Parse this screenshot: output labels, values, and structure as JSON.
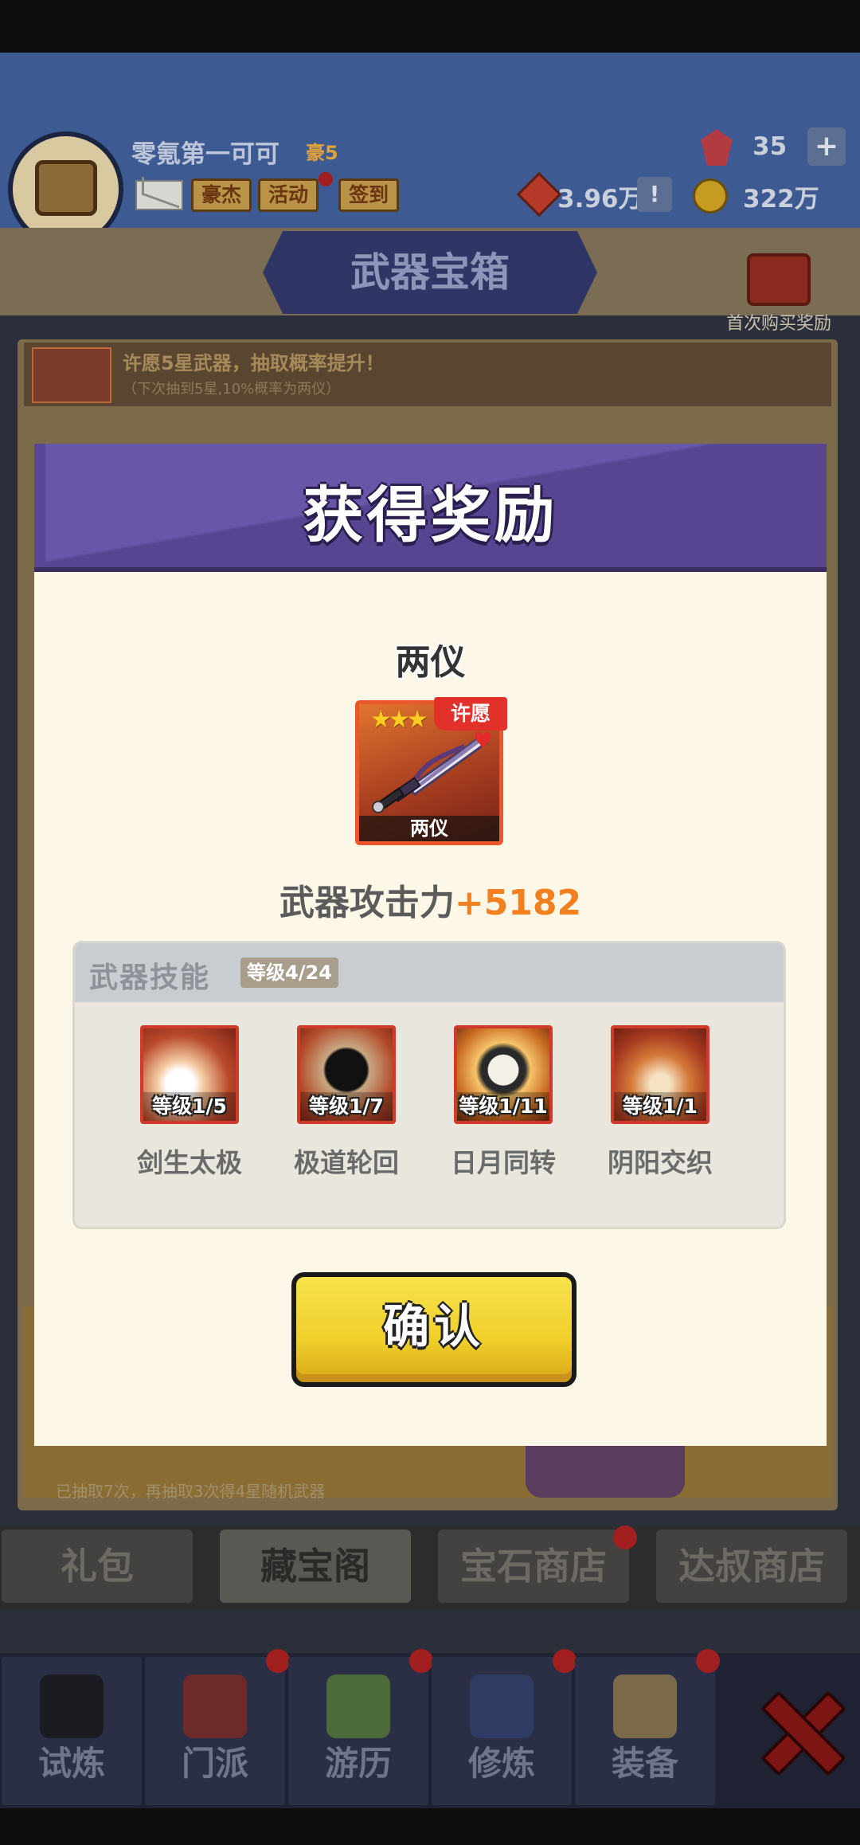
{
  "header": {
    "player_name": "零氪第一可可",
    "vip": "豪5",
    "buttons": [
      "豪杰",
      "活动",
      "签到"
    ],
    "power": "3.96万",
    "gems": "35",
    "gold": "322万",
    "excl": "!",
    "plus": "+"
  },
  "page": {
    "title": "武器宝箱",
    "first_buy_label": "首次购买奖励",
    "wish_text": "许愿5星武器，抽取概率提升！",
    "wish_sub": "（下次抽到5星,10%概率为两仪）",
    "chest_hint": "已抽取7次，再抽取3次得4星随机武器"
  },
  "shop_tabs": [
    "礼包",
    "藏宝阁",
    "宝石商店",
    "达叔商店"
  ],
  "bottom_nav": [
    "试炼",
    "门派",
    "游历",
    "修炼",
    "装备"
  ],
  "modal": {
    "title": "获得奖励",
    "weapon_name": "两仪",
    "card_label": "两仪",
    "stars": "★★★",
    "wish_badge": "许愿",
    "attack_label": "武器攻击力",
    "attack_value": "+5182",
    "skills_title": "武器技能",
    "skills_level": "等级4/24",
    "skills": [
      {
        "name": "剑生太极",
        "level": "等级1/5"
      },
      {
        "name": "极道轮回",
        "level": "等级1/7"
      },
      {
        "name": "日月同转",
        "level": "等级1/11"
      },
      {
        "name": "阴阳交织",
        "level": "等级1/1"
      }
    ],
    "confirm_label": "确认"
  },
  "colors": {
    "modal_header": "#6a56a8",
    "attack_value": "#f2801e",
    "confirm": "#f0cf2b"
  }
}
